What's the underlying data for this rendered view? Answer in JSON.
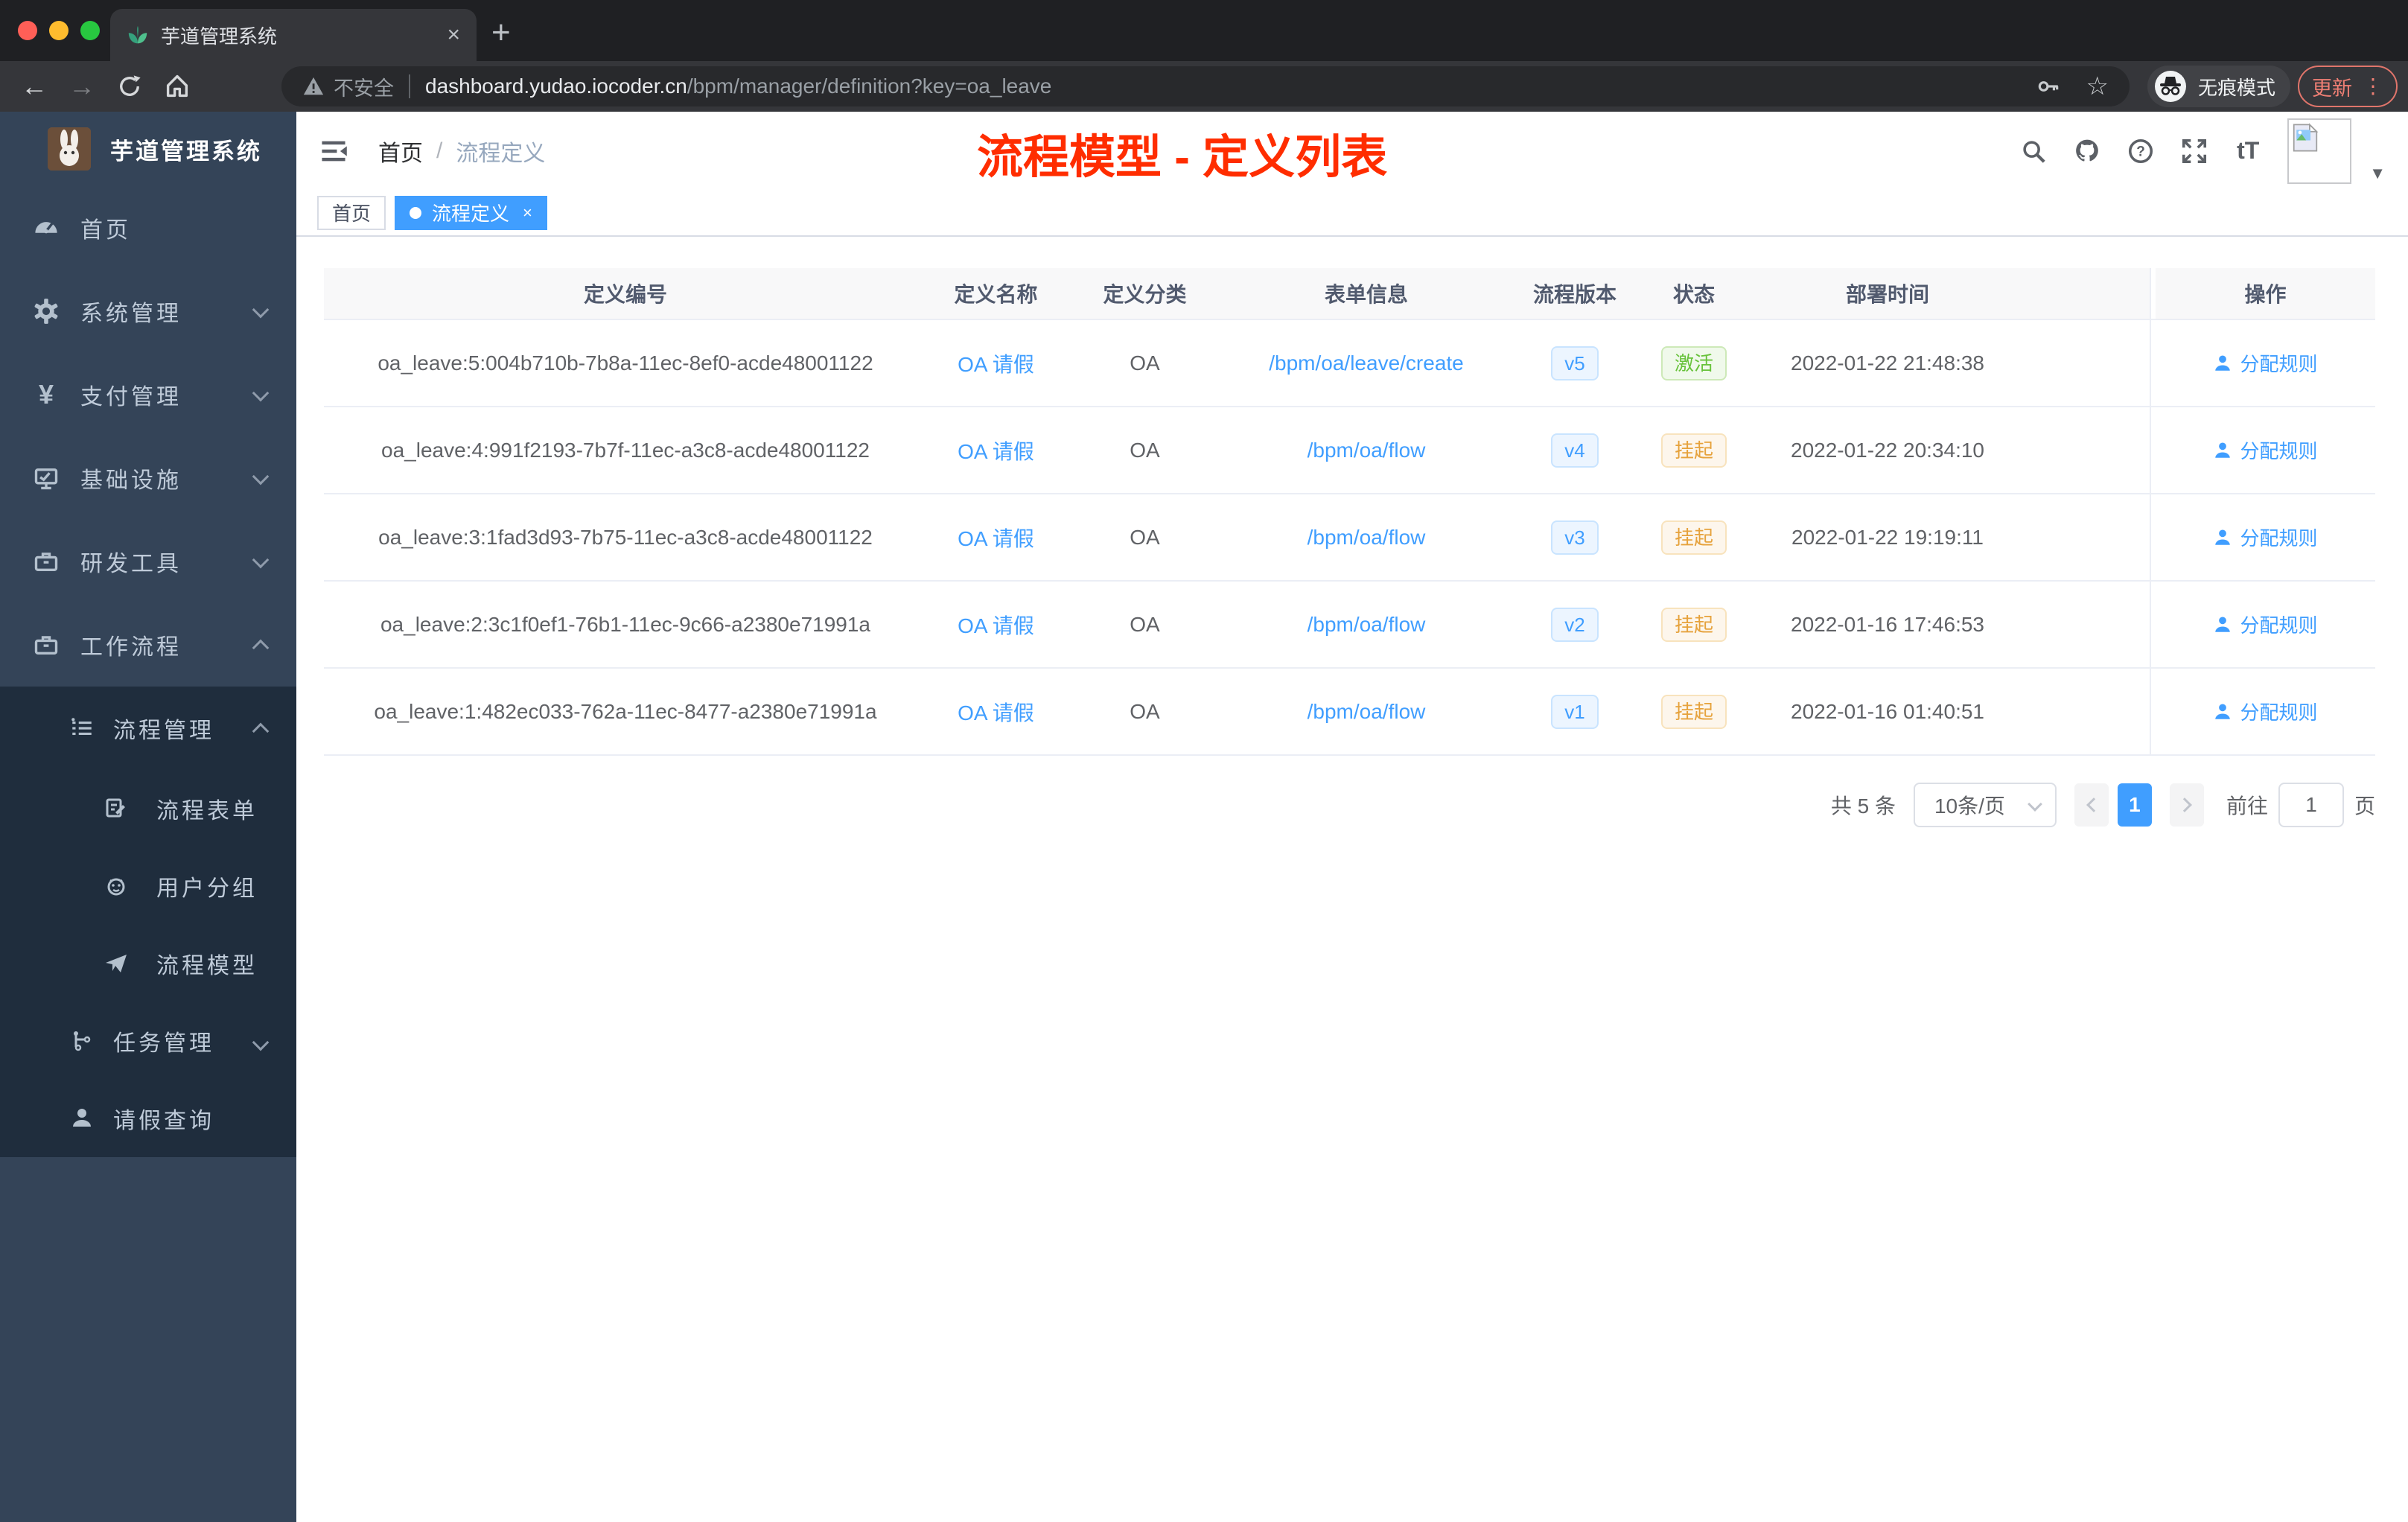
{
  "colors": {
    "accent": "#409eff",
    "annotation_red": "#ff2d00",
    "success": "#67c23a",
    "warning": "#e6a23c",
    "sidebar_bg": "#344458",
    "submenu_bg": "#1f2d3d"
  },
  "browser": {
    "tab_title": "芋道管理系统",
    "tab_close": "×",
    "new_tab": "+",
    "back": "←",
    "forward": "→",
    "security_label": "不安全",
    "url_domain": "dashboard.yudao.iocoder.cn",
    "url_path": "/bpm/manager/definition?key=oa_leave",
    "star": "☆",
    "incognito_label": "无痕模式",
    "update_label": "更新",
    "menu_dots": "⋮"
  },
  "sidebar": {
    "logo_title": "芋道管理系统",
    "items": [
      {
        "label": "首页"
      },
      {
        "label": "系统管理"
      },
      {
        "label": "支付管理"
      },
      {
        "label": "基础设施"
      },
      {
        "label": "研发工具"
      },
      {
        "label": "工作流程"
      }
    ],
    "yen_glyph": "¥",
    "submenu": {
      "process_mgmt": "流程管理",
      "children": [
        {
          "label": "流程表单"
        },
        {
          "label": "用户分组"
        },
        {
          "label": "流程模型"
        }
      ],
      "task_mgmt": "任务管理",
      "leave_query": "请假查询"
    }
  },
  "header": {
    "breadcrumb_home": "首页",
    "breadcrumb_separator": "/",
    "breadcrumb_current": "流程定义",
    "font_size_icon": "tT",
    "avatar_caret": "▼"
  },
  "annotation": {
    "text": "流程模型 - 定义列表"
  },
  "tags": {
    "home": "首页",
    "active": "流程定义",
    "close": "×"
  },
  "table": {
    "columns": [
      "定义编号",
      "定义名称",
      "定义分类",
      "表单信息",
      "流程版本",
      "状态",
      "部署时间",
      "操作"
    ],
    "rows": [
      {
        "id": "oa_leave:5:004b710b-7b8a-11ec-8ef0-acde48001122",
        "name": "OA 请假",
        "category": "OA",
        "form": "/bpm/oa/leave/create",
        "version": "v5",
        "status": "激活",
        "time": "2022-01-22 21:48:38",
        "action": "分配规则"
      },
      {
        "id": "oa_leave:4:991f2193-7b7f-11ec-a3c8-acde48001122",
        "name": "OA 请假",
        "category": "OA",
        "form": "/bpm/oa/flow",
        "version": "v4",
        "status": "挂起",
        "time": "2022-01-22 20:34:10",
        "action": "分配规则"
      },
      {
        "id": "oa_leave:3:1fad3d93-7b75-11ec-a3c8-acde48001122",
        "name": "OA 请假",
        "category": "OA",
        "form": "/bpm/oa/flow",
        "version": "v3",
        "status": "挂起",
        "time": "2022-01-22 19:19:11",
        "action": "分配规则"
      },
      {
        "id": "oa_leave:2:3c1f0ef1-76b1-11ec-9c66-a2380e71991a",
        "name": "OA 请假",
        "category": "OA",
        "form": "/bpm/oa/flow",
        "version": "v2",
        "status": "挂起",
        "time": "2022-01-16 17:46:53",
        "action": "分配规则"
      },
      {
        "id": "oa_leave:1:482ec033-762a-11ec-8477-a2380e71991a",
        "name": "OA 请假",
        "category": "OA",
        "form": "/bpm/oa/flow",
        "version": "v1",
        "status": "挂起",
        "time": "2022-01-16 01:40:51",
        "action": "分配规则"
      }
    ]
  },
  "pagination": {
    "total": "共 5 条",
    "page_size": "10条/页",
    "current_page": "1",
    "goto_prefix": "前往",
    "goto_value": "1",
    "goto_suffix": "页"
  }
}
